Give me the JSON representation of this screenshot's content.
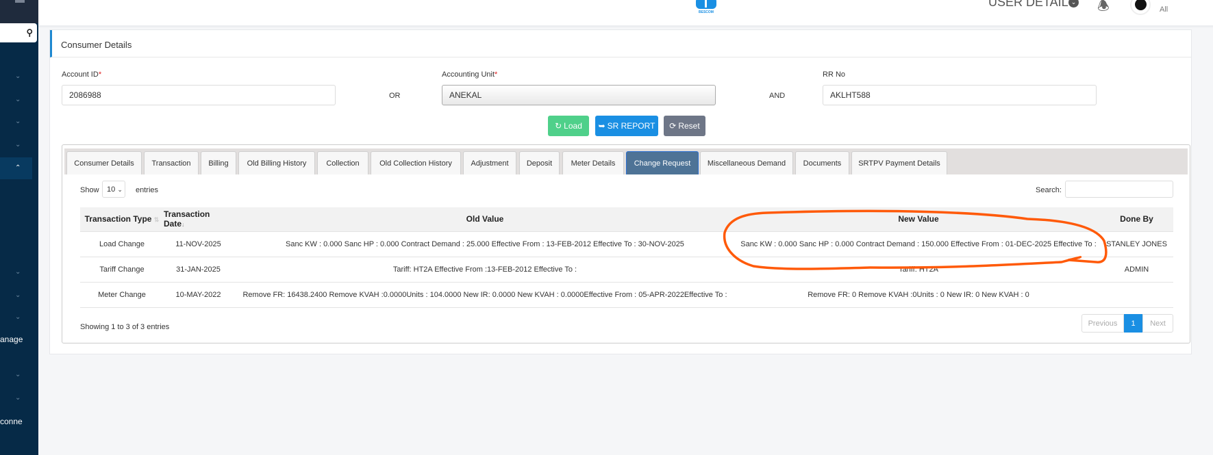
{
  "header": {
    "user_details": "USER DETAILS",
    "role": "All",
    "logo_text": "BESCOM"
  },
  "sidebar": {
    "partial_labels": [
      "anage",
      "conne"
    ]
  },
  "card": {
    "title": "Consumer Details"
  },
  "form": {
    "account_id_label": "Account ID",
    "account_id_value": "2086988",
    "or_label": "OR",
    "accounting_unit_label": "Accounting Unit",
    "accounting_unit_value": "ANEKAL",
    "and_label": "AND",
    "rr_no_label": "RR No",
    "rr_no_value": "AKLHT588",
    "required_mark": "*",
    "load_button": "Load",
    "sr_report_button": "SR REPORT",
    "reset_button": "Reset"
  },
  "tabs": [
    "Consumer Details",
    "Transaction",
    "Billing",
    "Old Billing History",
    "Collection",
    "Old Collection History",
    "Adjustment",
    "Deposit",
    "Meter Details",
    "Change Request",
    "Miscellaneous Demand",
    "Documents",
    "SRTPV Payment Details"
  ],
  "active_tab": "Change Request",
  "table_controls": {
    "show": "Show",
    "entries_value": "10",
    "entries": "entries",
    "search": "Search:",
    "info": "Showing 1 to 3 of 3 entries",
    "previous": "Previous",
    "page": "1",
    "next": "Next"
  },
  "table": {
    "columns": [
      "Transaction Type",
      "Transaction Date",
      "Old Value",
      "New Value",
      "Done By"
    ],
    "rows": [
      [
        "Load Change",
        "11-NOV-2025",
        "Sanc KW : 0.000 Sanc HP : 0.000 Contract Demand : 25.000 Effective From : 13-FEB-2012 Effective To : 30-NOV-2025",
        "Sanc KW : 0.000 Sanc HP : 0.000 Contract Demand : 150.000 Effective From : 01-DEC-2025 Effective To :",
        "STANLEY JONES"
      ],
      [
        "Tariff Change",
        "31-JAN-2025",
        "Tariff: HT2A Effective From :13-FEB-2012 Effective To :",
        "Tariff: HT2A",
        "ADMIN"
      ],
      [
        "Meter Change",
        "10-MAY-2022",
        "Remove FR: 16438.2400 Remove KVAH :0.0000Units : 104.0000 New IR: 0.0000 New KVAH : 0.0000Effective From : 05-APR-2022Effective To :",
        "Remove FR: 0 Remove KVAH :0Units : 0 New IR: 0 New KVAH : 0",
        ""
      ]
    ]
  },
  "colors": {
    "sidebar": "#062a47",
    "accent": "#1e88d1",
    "load": "#4fd08a",
    "sr": "#1a8fe3",
    "reset": "#6e7687",
    "annotation": "#ff5a0a"
  }
}
